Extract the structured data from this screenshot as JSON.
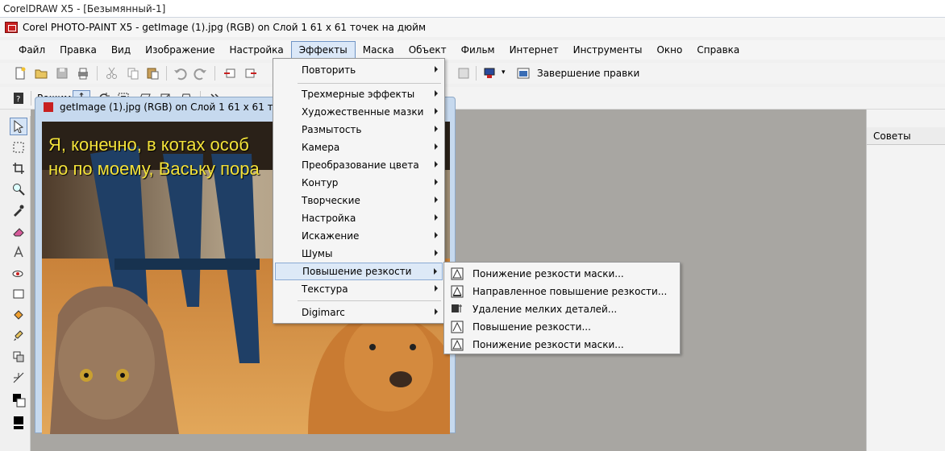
{
  "outer_title": "CorelDRAW X5 - [Безымянный-1]",
  "app": {
    "title": "Corel PHOTO-PAINT X5 - getImage (1).jpg (RGB) on Слой 1 61 x 61 точек на дюйм"
  },
  "menubar": [
    "Файл",
    "Правка",
    "Вид",
    "Изображение",
    "Настройка",
    "Эффекты",
    "Маска",
    "Объект",
    "Фильм",
    "Интернет",
    "Инструменты",
    "Окно",
    "Справка"
  ],
  "toolbar": {
    "finish_label": "Завершение правки",
    "mode_label": "Режим"
  },
  "document": {
    "title": "getImage (1).jpg (RGB) on Слой 1 61 x 61 точек на",
    "caption_line1": "Я, конечно, в котах особ",
    "caption_line2": "но по моему, Ваську пора"
  },
  "right_panel": {
    "title": "Советы"
  },
  "effects_menu": [
    {
      "label": "Повторить",
      "submenu": true
    },
    {
      "label": "Трехмерные эффекты",
      "submenu": true
    },
    {
      "label": "Художественные мазки",
      "submenu": true
    },
    {
      "label": "Размытость",
      "submenu": true
    },
    {
      "label": "Камера",
      "submenu": true
    },
    {
      "label": "Преобразование цвета",
      "submenu": true
    },
    {
      "label": "Контур",
      "submenu": true
    },
    {
      "label": "Творческие",
      "submenu": true
    },
    {
      "label": "Настройка",
      "submenu": true
    },
    {
      "label": "Искажение",
      "submenu": true
    },
    {
      "label": "Шумы",
      "submenu": true
    },
    {
      "label": "Повышение резкости",
      "submenu": true,
      "highlighted": true
    },
    {
      "label": "Текстура",
      "submenu": true
    },
    {
      "label": "Digimarc",
      "submenu": true
    }
  ],
  "sharpen_submenu": [
    "Понижение резкости маски...",
    "Направленное повышение резкости...",
    "Удаление мелких деталей...",
    "Повышение резкости...",
    "Понижение резкости маски..."
  ],
  "colors": {
    "caption": "#f3e23a",
    "highlight": "#dde9f7",
    "workspace": "#a8a6a2"
  }
}
